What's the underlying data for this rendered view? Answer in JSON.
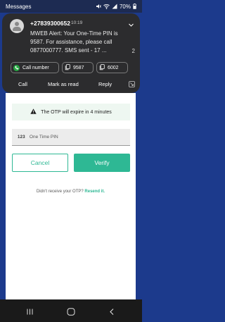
{
  "status_bar": {
    "app_name": "Messages",
    "battery": "70%",
    "icons": [
      "wifi-icon",
      "signal-icon",
      "mute-icon",
      "battery-icon"
    ]
  },
  "notification": {
    "sender": "+27839300652",
    "time": "10:19",
    "body": "MWEB Alert: Your One-Time PIN is 9587. For assistance, please call 0877000777. SMS sent - 17 ...",
    "count": "2",
    "chips": {
      "call_label": "Call number",
      "code1": "9587",
      "code2": "6002"
    },
    "actions": {
      "call": "Call",
      "mark_read": "Mark as read",
      "reply": "Reply"
    }
  },
  "page": {
    "info_text": "The OTP will expire in 4 minutes",
    "otp_placeholder": "One Time PIN",
    "otp_prefix": "123",
    "cancel_label": "Cancel",
    "verify_label": "Verify",
    "resend_prompt": "Didn't receive your OTP?",
    "resend_link": "Resend it."
  },
  "colors": {
    "accent": "#2eb894",
    "background": "#1c3a8c",
    "notification_bg": "#2c2c2e",
    "call_chip_icon": "#26a642"
  }
}
